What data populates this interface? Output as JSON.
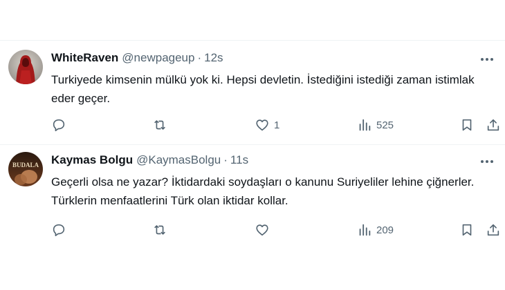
{
  "tweets": [
    {
      "name": "WhiteRaven",
      "handle": "@newpageup",
      "separator": "·",
      "time": "12s",
      "text": "Turkiyede kimsenin mülkü yok ki. Hepsi devletin. İstediğini istediği zaman istimlak eder geçer.",
      "reply_count": "",
      "retweet_count": "",
      "like_count": "1",
      "view_count": "525",
      "avatar_icon": "red-hooded-figure-avatar"
    },
    {
      "name": "Kaymas Bolgu",
      "handle": "@KaymasBolgu",
      "separator": "·",
      "time": "11s",
      "text": "Geçerli olsa ne yazar? İktidardaki soydaşları o kanunu Suriyeliler lehine çiğnerler. Türklerin menfaatlerini Türk olan iktidar kollar.",
      "reply_count": "",
      "retweet_count": "",
      "like_count": "",
      "view_count": "209",
      "avatar_text": "BUDALA",
      "avatar_icon": "movie-poster-avatar"
    }
  ],
  "colors": {
    "text": "#0f1419",
    "secondary": "#536471",
    "divider": "#eff3f4"
  }
}
